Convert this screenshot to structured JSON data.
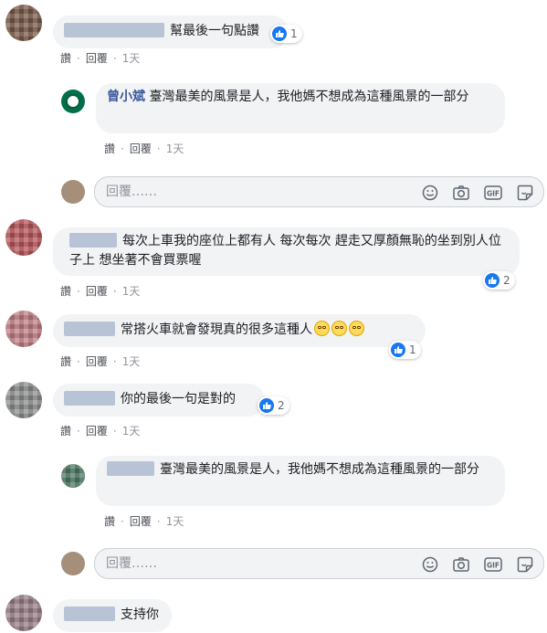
{
  "actions": {
    "like": "讚",
    "reply": "回覆",
    "time": "1天"
  },
  "reply_box": {
    "placeholder": "回覆……"
  },
  "comments": [
    {
      "text": "幫最後一句點讚",
      "likes": "1"
    },
    {
      "name": "曾小斌",
      "text": "臺灣最美的風景是人，我他媽不想成為這種風景的一部分"
    },
    {
      "text": "每次上車我的座位上都有人 每次每次 趕走又厚顏無恥的坐到別人位子上 想坐著不會買票喔",
      "likes": "2"
    },
    {
      "text": "常搭火車就會發現真的很多這種人",
      "likes": "1"
    },
    {
      "text": "你的最後一句是對的",
      "likes": "2"
    },
    {
      "text": "臺灣最美的風景是人，我他媽不想成為這種風景的一部分"
    },
    {
      "text": "支持你"
    }
  ],
  "colors": {
    "like_blue": "#1877f2",
    "name": "#385898",
    "bubble": "#f2f3f5"
  }
}
